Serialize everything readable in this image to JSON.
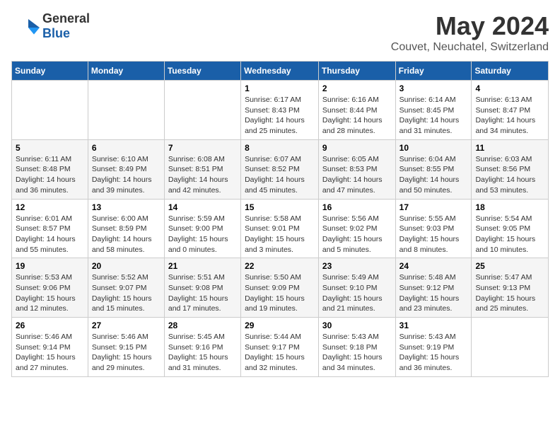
{
  "logo": {
    "general": "General",
    "blue": "Blue"
  },
  "title": "May 2024",
  "location": "Couvet, Neuchatel, Switzerland",
  "days_of_week": [
    "Sunday",
    "Monday",
    "Tuesday",
    "Wednesday",
    "Thursday",
    "Friday",
    "Saturday"
  ],
  "weeks": [
    [
      {
        "day": "",
        "info": ""
      },
      {
        "day": "",
        "info": ""
      },
      {
        "day": "",
        "info": ""
      },
      {
        "day": "1",
        "info": "Sunrise: 6:17 AM\nSunset: 8:43 PM\nDaylight: 14 hours\nand 25 minutes."
      },
      {
        "day": "2",
        "info": "Sunrise: 6:16 AM\nSunset: 8:44 PM\nDaylight: 14 hours\nand 28 minutes."
      },
      {
        "day": "3",
        "info": "Sunrise: 6:14 AM\nSunset: 8:45 PM\nDaylight: 14 hours\nand 31 minutes."
      },
      {
        "day": "4",
        "info": "Sunrise: 6:13 AM\nSunset: 8:47 PM\nDaylight: 14 hours\nand 34 minutes."
      }
    ],
    [
      {
        "day": "5",
        "info": "Sunrise: 6:11 AM\nSunset: 8:48 PM\nDaylight: 14 hours\nand 36 minutes."
      },
      {
        "day": "6",
        "info": "Sunrise: 6:10 AM\nSunset: 8:49 PM\nDaylight: 14 hours\nand 39 minutes."
      },
      {
        "day": "7",
        "info": "Sunrise: 6:08 AM\nSunset: 8:51 PM\nDaylight: 14 hours\nand 42 minutes."
      },
      {
        "day": "8",
        "info": "Sunrise: 6:07 AM\nSunset: 8:52 PM\nDaylight: 14 hours\nand 45 minutes."
      },
      {
        "day": "9",
        "info": "Sunrise: 6:05 AM\nSunset: 8:53 PM\nDaylight: 14 hours\nand 47 minutes."
      },
      {
        "day": "10",
        "info": "Sunrise: 6:04 AM\nSunset: 8:55 PM\nDaylight: 14 hours\nand 50 minutes."
      },
      {
        "day": "11",
        "info": "Sunrise: 6:03 AM\nSunset: 8:56 PM\nDaylight: 14 hours\nand 53 minutes."
      }
    ],
    [
      {
        "day": "12",
        "info": "Sunrise: 6:01 AM\nSunset: 8:57 PM\nDaylight: 14 hours\nand 55 minutes."
      },
      {
        "day": "13",
        "info": "Sunrise: 6:00 AM\nSunset: 8:59 PM\nDaylight: 14 hours\nand 58 minutes."
      },
      {
        "day": "14",
        "info": "Sunrise: 5:59 AM\nSunset: 9:00 PM\nDaylight: 15 hours\nand 0 minutes."
      },
      {
        "day": "15",
        "info": "Sunrise: 5:58 AM\nSunset: 9:01 PM\nDaylight: 15 hours\nand 3 minutes."
      },
      {
        "day": "16",
        "info": "Sunrise: 5:56 AM\nSunset: 9:02 PM\nDaylight: 15 hours\nand 5 minutes."
      },
      {
        "day": "17",
        "info": "Sunrise: 5:55 AM\nSunset: 9:03 PM\nDaylight: 15 hours\nand 8 minutes."
      },
      {
        "day": "18",
        "info": "Sunrise: 5:54 AM\nSunset: 9:05 PM\nDaylight: 15 hours\nand 10 minutes."
      }
    ],
    [
      {
        "day": "19",
        "info": "Sunrise: 5:53 AM\nSunset: 9:06 PM\nDaylight: 15 hours\nand 12 minutes."
      },
      {
        "day": "20",
        "info": "Sunrise: 5:52 AM\nSunset: 9:07 PM\nDaylight: 15 hours\nand 15 minutes."
      },
      {
        "day": "21",
        "info": "Sunrise: 5:51 AM\nSunset: 9:08 PM\nDaylight: 15 hours\nand 17 minutes."
      },
      {
        "day": "22",
        "info": "Sunrise: 5:50 AM\nSunset: 9:09 PM\nDaylight: 15 hours\nand 19 minutes."
      },
      {
        "day": "23",
        "info": "Sunrise: 5:49 AM\nSunset: 9:10 PM\nDaylight: 15 hours\nand 21 minutes."
      },
      {
        "day": "24",
        "info": "Sunrise: 5:48 AM\nSunset: 9:12 PM\nDaylight: 15 hours\nand 23 minutes."
      },
      {
        "day": "25",
        "info": "Sunrise: 5:47 AM\nSunset: 9:13 PM\nDaylight: 15 hours\nand 25 minutes."
      }
    ],
    [
      {
        "day": "26",
        "info": "Sunrise: 5:46 AM\nSunset: 9:14 PM\nDaylight: 15 hours\nand 27 minutes."
      },
      {
        "day": "27",
        "info": "Sunrise: 5:46 AM\nSunset: 9:15 PM\nDaylight: 15 hours\nand 29 minutes."
      },
      {
        "day": "28",
        "info": "Sunrise: 5:45 AM\nSunset: 9:16 PM\nDaylight: 15 hours\nand 31 minutes."
      },
      {
        "day": "29",
        "info": "Sunrise: 5:44 AM\nSunset: 9:17 PM\nDaylight: 15 hours\nand 32 minutes."
      },
      {
        "day": "30",
        "info": "Sunrise: 5:43 AM\nSunset: 9:18 PM\nDaylight: 15 hours\nand 34 minutes."
      },
      {
        "day": "31",
        "info": "Sunrise: 5:43 AM\nSunset: 9:19 PM\nDaylight: 15 hours\nand 36 minutes."
      },
      {
        "day": "",
        "info": ""
      }
    ]
  ]
}
